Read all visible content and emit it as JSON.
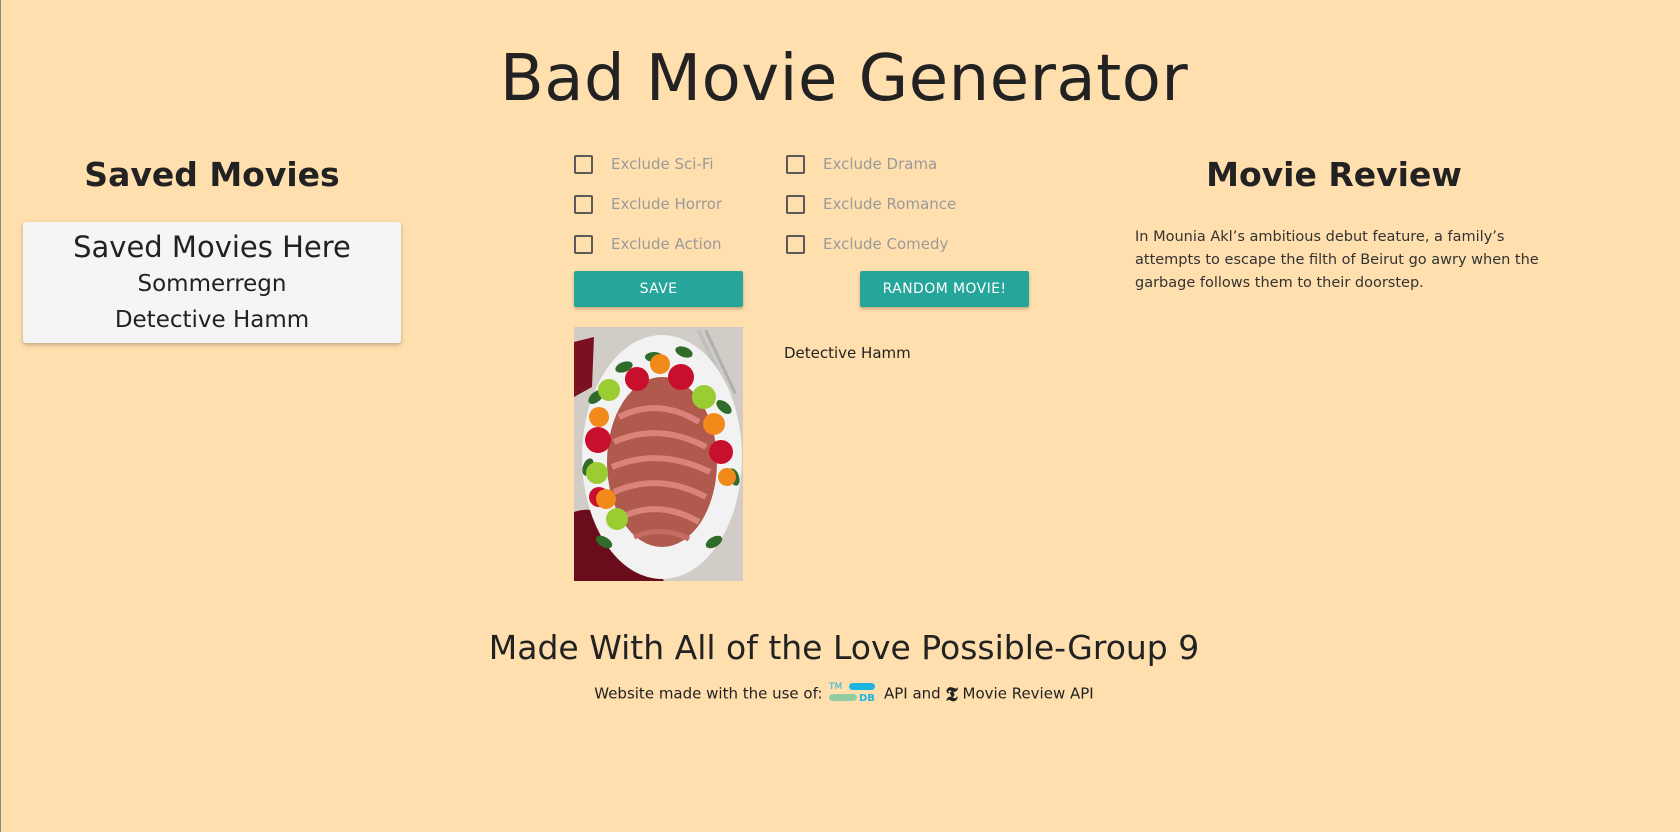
{
  "page": {
    "title": "Bad Movie Generator"
  },
  "saved": {
    "heading": "Saved Movies",
    "card_title": "Saved Movies Here",
    "items": [
      "Sommerregn",
      "Detective Hamm"
    ]
  },
  "filters": {
    "sci_fi": "Exclude Sci-Fi",
    "drama": "Exclude Drama",
    "horror": "Exclude Horror",
    "romance": "Exclude Romance",
    "action": "Exclude Action",
    "comedy": "Exclude Comedy"
  },
  "buttons": {
    "save": "Save",
    "random": "Random Movie!"
  },
  "movie": {
    "title": "Detective Hamm"
  },
  "review": {
    "heading": "Movie Review",
    "text": "In Mounia Akl’s ambitious debut feature, a family’s attempts to escape the filth of Beirut go awry when the garbage follows them to their doorstep."
  },
  "footer": {
    "title": "Made With All of the Love Possible-Group 9",
    "credits_prefix": "Website made with the use of:",
    "tmdb_suffix": "API and",
    "nyt_suffix": "Movie Review API",
    "tmdb_logo_text_top": "TM",
    "tmdb_logo_text_bottom": "DB",
    "nyt_logo_glyph": "𝕿"
  },
  "colors": {
    "background": "#ffdfae",
    "button": "#26a69a",
    "card": "#f5f5f5"
  }
}
